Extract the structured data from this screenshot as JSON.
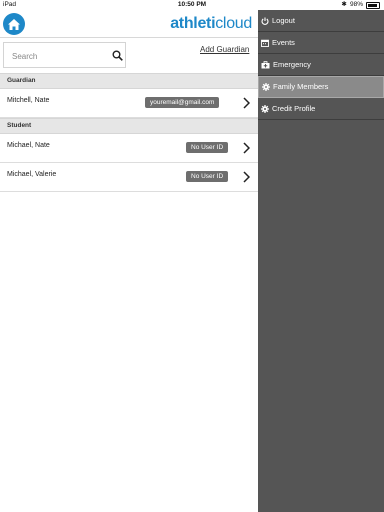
{
  "status_bar": {
    "carrier": "iPad",
    "time": "10:50 PM",
    "battery": "98%"
  },
  "header": {
    "brand_bold": "athleti",
    "brand_light": "cloud"
  },
  "search": {
    "placeholder": "Search"
  },
  "actions": {
    "add_guardian": "Add Guardian"
  },
  "sections": {
    "guardian": {
      "title": "Guardian",
      "rows": [
        {
          "name": "Mitchell, Nate",
          "badge": "youremail@gmail.com"
        }
      ]
    },
    "student": {
      "title": "Student",
      "rows": [
        {
          "name": "Michael, Nate",
          "badge": "No User ID"
        },
        {
          "name": "Michael, Valerie",
          "badge": "No User ID"
        }
      ]
    }
  },
  "menu": {
    "items": [
      {
        "label": "Logout",
        "icon": "power-icon"
      },
      {
        "label": "Events",
        "icon": "calendar-icon"
      },
      {
        "label": "Emergency",
        "icon": "medkit-icon"
      },
      {
        "label": "Family Members",
        "icon": "gear-icon",
        "active": true
      },
      {
        "label": "Credit Profile",
        "icon": "gear-icon"
      }
    ]
  },
  "colors": {
    "brand_blue": "#1e88c8",
    "menu_bg": "#555555",
    "badge_bg": "#6e6e6e"
  }
}
